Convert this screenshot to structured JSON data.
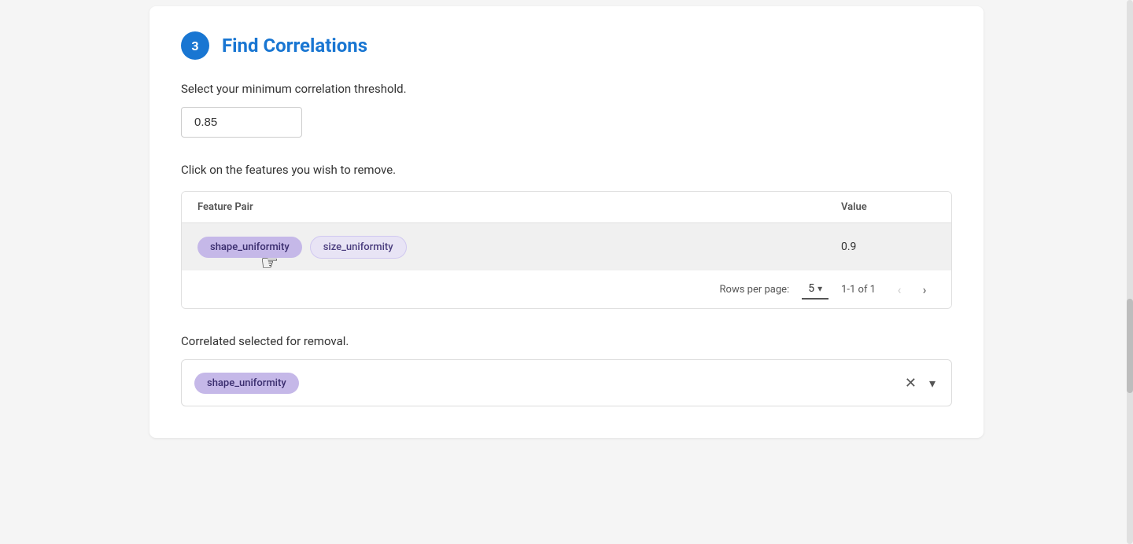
{
  "page": {
    "step": {
      "number": "3",
      "title": "Find Correlations"
    },
    "threshold": {
      "label": "Select your minimum correlation threshold.",
      "value": "0.85"
    },
    "features_table": {
      "click_label": "Click on the features you wish to remove.",
      "columns": [
        {
          "key": "feature_pair",
          "label": "Feature Pair"
        },
        {
          "key": "value",
          "label": "Value"
        }
      ],
      "rows": [
        {
          "features": [
            "shape_uniformity",
            "size_uniformity"
          ],
          "selected": [
            "shape_uniformity"
          ],
          "value": "0.9"
        }
      ],
      "footer": {
        "rows_per_page_label": "Rows per page:",
        "rows_per_page_value": "5",
        "pagination_info": "1-1 of 1"
      }
    },
    "removal": {
      "label": "Correlated selected for removal.",
      "selected_features": [
        "shape_uniformity"
      ]
    }
  }
}
